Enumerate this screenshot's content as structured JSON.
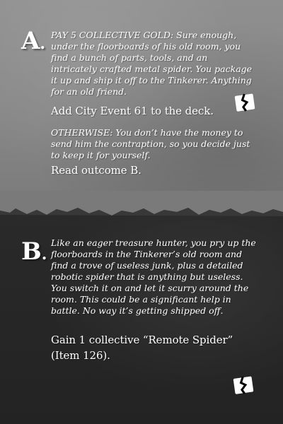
{
  "section_a": {
    "letter": "A",
    "pay_text": "PAY 5 COLLECTIVE GOLD: Sure enough, under the floorboards of his old room, you find a bunch of parts, tools, and an intricately crafted metal spider. You package it up and ship it off to the Tinkerer. Anything for an old friend.",
    "pay_outcome": "Add City Event 61 to the deck.",
    "otherwise_text": "OTHERWISE: You don’t have the money to send him the contraption, so you decide just to keep it for yourself.",
    "otherwise_outcome": "Read outcome B.",
    "end_icon": "torn-card-icon"
  },
  "section_b": {
    "letter": "B",
    "story_text": "Like an eager treasure hunter, you pry up the floorboards in the Tinkerer’s old room and find a trove of useless junk, plus a detailed robotic spider that is anything but useless. You switch it on and let it scurry around the room. This could be a significant help in battle. No way it’s getting shipped off.",
    "outcome": "Gain 1 collective “Remote Spider” (Item 126).",
    "end_icon": "torn-card-icon"
  },
  "colors": {
    "top_background": "#868686",
    "bottom_background": "#232323",
    "text": "#ffffff"
  }
}
